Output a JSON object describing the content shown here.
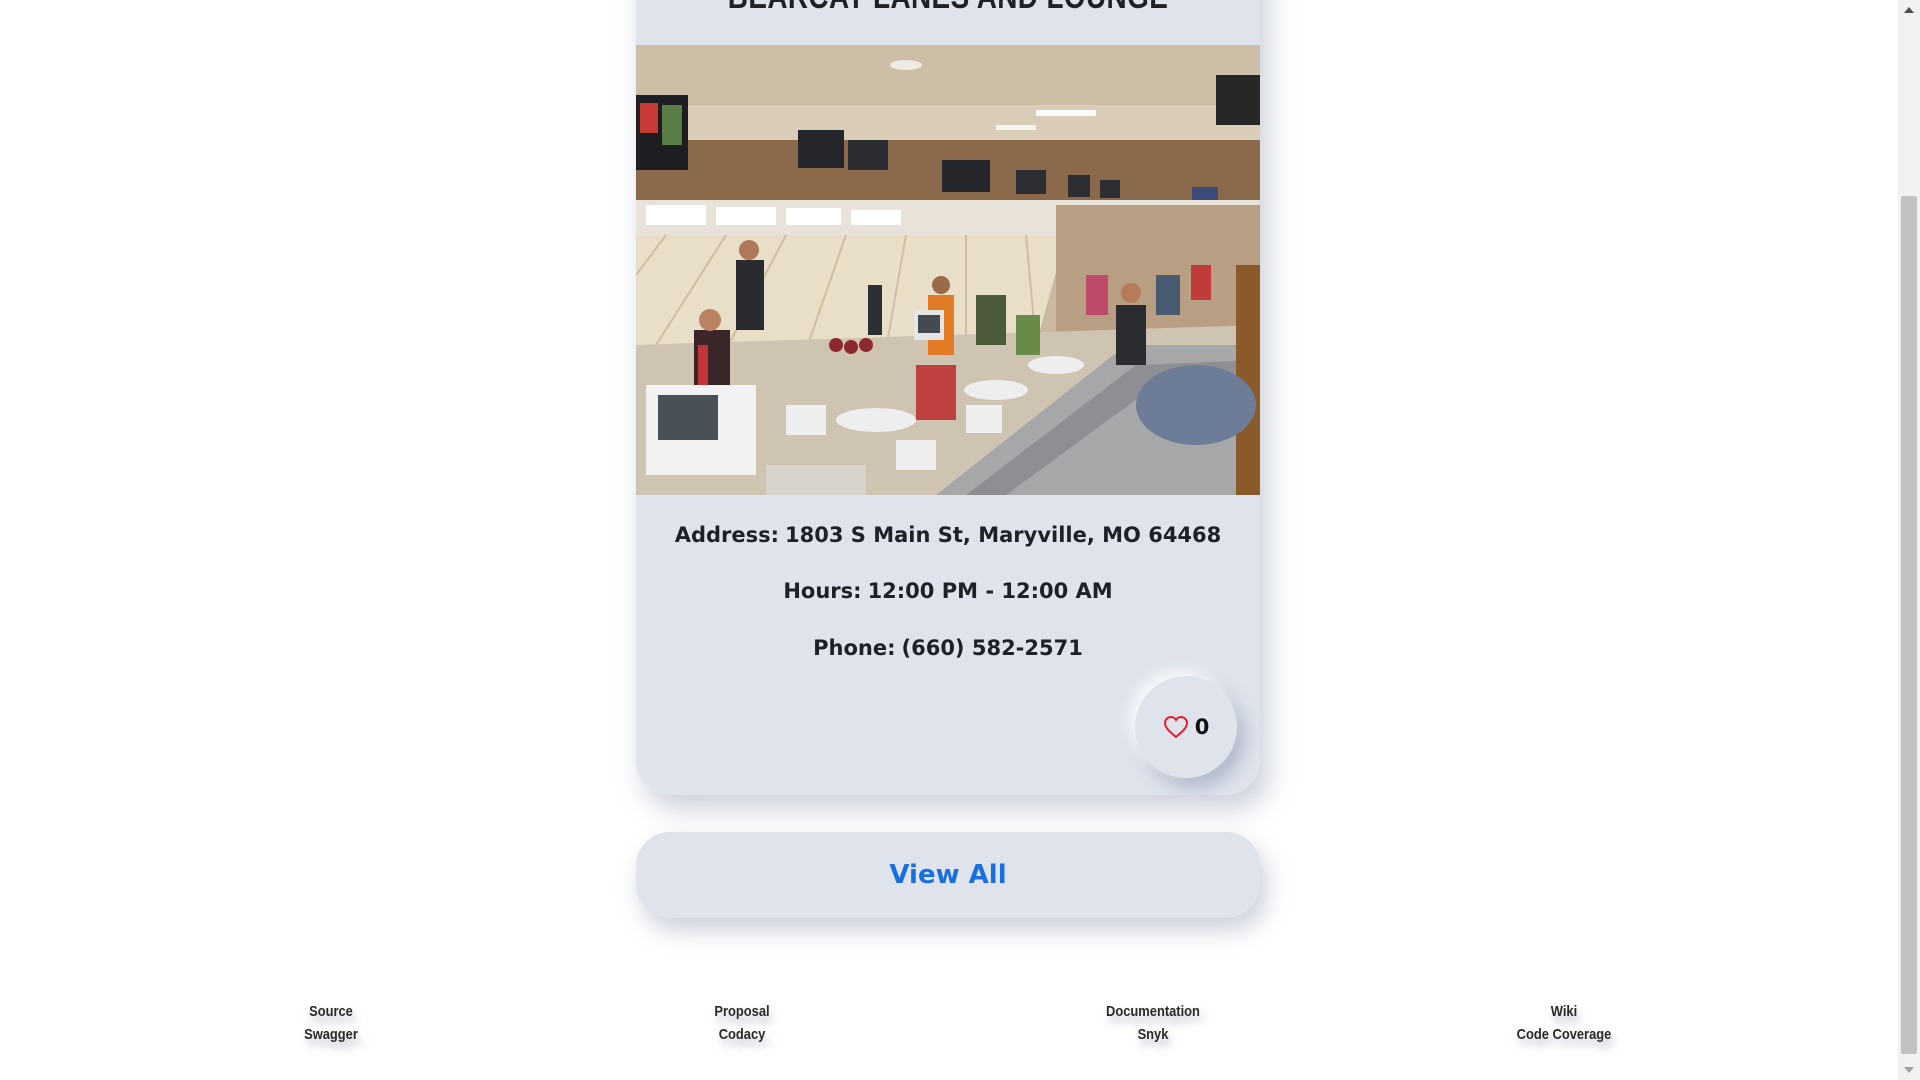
{
  "card": {
    "title": "BEARCAT LANES AND LOUNGE",
    "photo_alt": "bowling-alley-photo",
    "address_label": "Address:",
    "address_value": "1803 S Main St, Maryville, MO 64468",
    "hours_label": "Hours:",
    "hours_value": "12:00 PM - 12:00 AM",
    "phone_label": "Phone:",
    "phone_value": "(660) 582-2571",
    "like_icon": "heart-icon",
    "like_count": "0"
  },
  "view_all": {
    "label": "View All"
  },
  "footer": {
    "columns": [
      {
        "top": "Source",
        "bottom": "Swagger"
      },
      {
        "top": "Proposal",
        "bottom": "Codacy"
      },
      {
        "top": "Documentation",
        "bottom": "Snyk"
      },
      {
        "top": "Wiki",
        "bottom": "Code Coverage"
      }
    ]
  },
  "colors": {
    "card_background": "#dfe4ec",
    "link_blue": "#1a6fe0",
    "heart_red": "#e0212b",
    "text_dark": "#1e2125"
  }
}
